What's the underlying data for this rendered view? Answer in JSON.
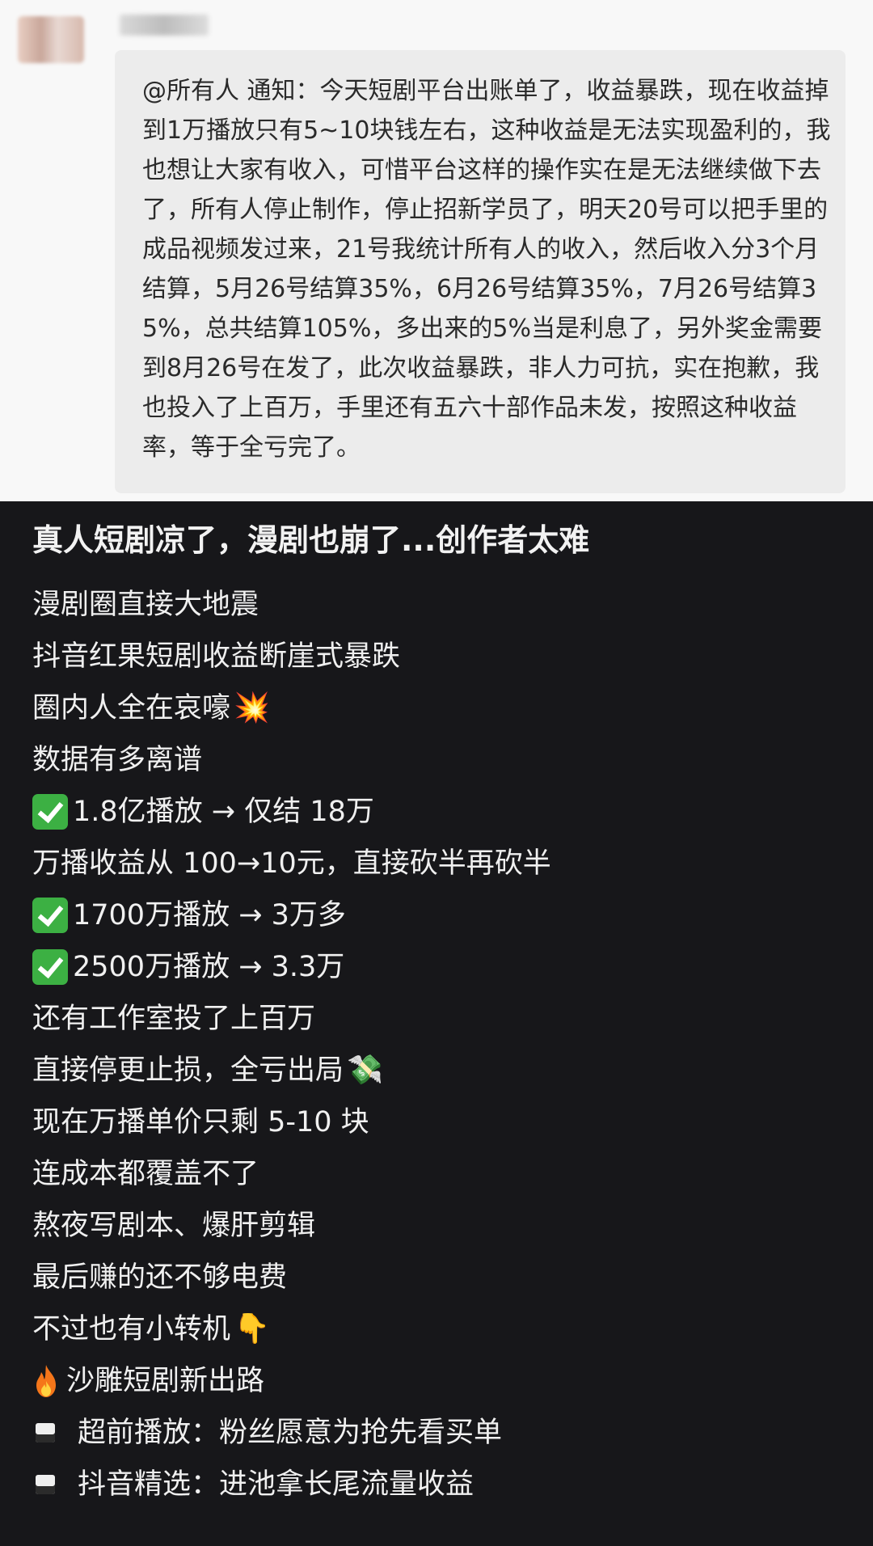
{
  "chat": {
    "sender_name": "",
    "message": "@所有人 通知：今天短剧平台出账单了，收益暴跌，现在收益掉到1万播放只有5~10块钱左右，这种收益是无法实现盈利的，我也想让大家有收入，可惜平台这样的操作实在是无法继续做下去了，所有人停止制作，停止招新学员了，明天20号可以把手里的成品视频发过来，21号我统计所有人的收入，然后收入分3个月结算，5月26号结算35%，6月26号结算35%，7月26号结算35%，总共结算105%，多出来的5%当是利息了，另外奖金需要到8月26号在发了，此次收益暴跌，非人力可抗，实在抱歉，我也投入了上百万，手里还有五六十部作品未发，按照这种收益率，等于全亏完了。"
  },
  "post": {
    "title": "真人短剧凉了，漫剧也崩了...创作者太难",
    "lines": [
      {
        "icon": "",
        "text": "漫剧圈直接大地震"
      },
      {
        "icon": "",
        "text": "抖音红果短剧收益断崖式暴跌"
      },
      {
        "icon": "collision-icon",
        "glyph": "💥",
        "text": "圈内人全在哀嚎"
      },
      {
        "icon": "",
        "text": "数据有多离谱"
      },
      {
        "icon": "check-icon",
        "text": "1.8亿播放 → 仅结 18万"
      },
      {
        "icon": "",
        "text": "万播收益从 100→10元，直接砍半再砍半"
      },
      {
        "icon": "check-icon",
        "text": "1700万播放 → 3万多"
      },
      {
        "icon": "check-icon",
        "text": "2500万播放 → 3.3万"
      },
      {
        "icon": "",
        "text": "还有工作室投了上百万"
      },
      {
        "icon": "money-wings-icon",
        "glyph": "💸",
        "text": "直接停更止损，全亏出局"
      },
      {
        "icon": "",
        "text": "现在万播单价只剩 5-10 块"
      },
      {
        "icon": "",
        "text": "连成本都覆盖不了"
      },
      {
        "icon": "",
        "text": "熬夜写剧本、爆肝剪辑"
      },
      {
        "icon": "",
        "text": "最后赚的还不够电费"
      },
      {
        "icon": "pointing-down-icon",
        "glyph": "👇",
        "text": "不过也有小转机"
      },
      {
        "icon": "fire-icon",
        "text": "沙雕短剧新出路"
      },
      {
        "icon": "square-icon",
        "text": "超前播放：粉丝愿意为抢先看买单"
      },
      {
        "icon": "square-icon",
        "text": "抖音精选：进池拿长尾流量收益"
      }
    ]
  },
  "colors": {
    "chat_background": "#f8f8f8",
    "bubble": "#ececec",
    "post_background": "#17171a",
    "check_green": "#3cb043",
    "fire_orange": "#f5761a"
  }
}
